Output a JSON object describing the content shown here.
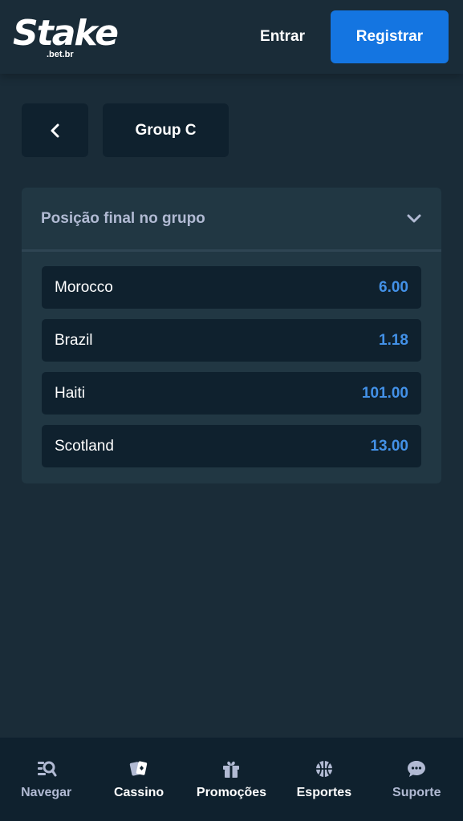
{
  "header": {
    "logo_text": "Stake",
    "logo_sub": ".bet.br",
    "login_label": "Entrar",
    "register_label": "Registrar"
  },
  "breadcrumb": {
    "back_icon": "chevron-left-icon",
    "group_label": "Group C"
  },
  "market": {
    "title": "Posição final no grupo",
    "expand_icon": "chevron-down-icon",
    "outcomes": [
      {
        "name": "Morocco",
        "odds": "6.00"
      },
      {
        "name": "Brazil",
        "odds": "1.18"
      },
      {
        "name": "Haiti",
        "odds": "101.00"
      },
      {
        "name": "Scotland",
        "odds": "13.00"
      }
    ]
  },
  "bottom_nav": {
    "items": [
      {
        "label": "Navegar",
        "icon": "browse-search-icon"
      },
      {
        "label": "Cassino",
        "icon": "playing-cards-icon"
      },
      {
        "label": "Promoções",
        "icon": "gift-icon"
      },
      {
        "label": "Esportes",
        "icon": "basketball-icon"
      },
      {
        "label": "Suporte",
        "icon": "chat-bubble-icon"
      }
    ]
  },
  "colors": {
    "background": "#1a2c38",
    "card": "#213743",
    "dark_surface": "#0f212e",
    "accent_blue": "#1475e1",
    "odds_blue": "#4391e7",
    "muted_text": "#b1bad3"
  }
}
